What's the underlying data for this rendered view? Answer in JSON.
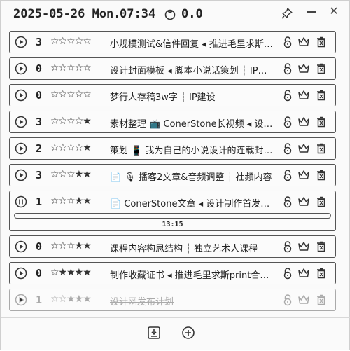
{
  "header": {
    "date": "2025-05-26 Mon.",
    "time": "07:34",
    "score": "0.0"
  },
  "tasks": [
    {
      "count": "3",
      "stars": "☆☆☆☆☆",
      "title": "小规模测试&信件回复 ◂ 推进毛里求斯…",
      "expanded": false,
      "done": false
    },
    {
      "count": "0",
      "stars": "☆☆☆☆☆",
      "title": "设计封面模板 ◂ 脚本小说话策划 ┆ IP…",
      "expanded": false,
      "done": false
    },
    {
      "count": "0",
      "stars": "☆☆☆☆☆",
      "title": "梦行人存稿3w字 ┆ IP建设",
      "expanded": false,
      "done": false
    },
    {
      "count": "3",
      "stars": "☆☆☆☆★",
      "title": "素材整理 📺 ConerStone长视频 ◂ 设…",
      "expanded": false,
      "done": false
    },
    {
      "count": "2",
      "stars": "☆☆☆☆★",
      "title": "策划 📱 我为自己的小说设计的连载封…",
      "expanded": false,
      "done": false
    },
    {
      "count": "3",
      "stars": "☆☆☆★★",
      "title": "📄 🎙 播客2文章&音频调整 ┆ 社频内容",
      "expanded": false,
      "done": false
    },
    {
      "count": "1",
      "stars": "☆☆☆★★",
      "title": "📄 ConerStone文章 ◂ 设计制作首发…",
      "expanded": true,
      "done": false,
      "progress_time": "13:15"
    },
    {
      "count": "0",
      "stars": "☆☆☆★★",
      "title": "课程内容构思结构 ┆ 独立艺术人课程",
      "expanded": false,
      "done": false
    },
    {
      "count": "0",
      "stars": "☆★★★★",
      "title": "制作收藏证书 ◂ 推进毛里求斯print合…",
      "expanded": false,
      "done": false
    },
    {
      "count": "1",
      "stars": "☆☆★★★",
      "title": "设计网发布计划",
      "expanded": false,
      "done": true
    }
  ]
}
